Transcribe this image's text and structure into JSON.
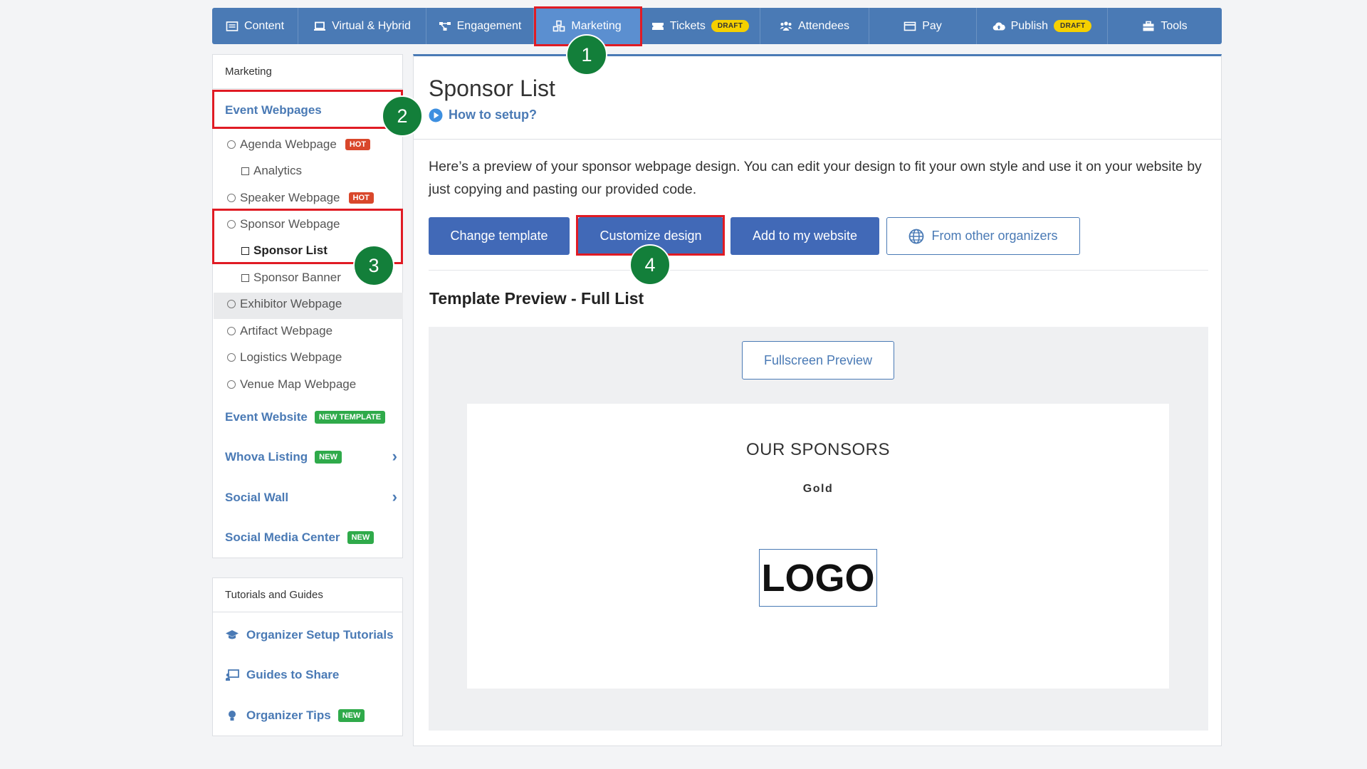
{
  "topnav": {
    "tabs": [
      {
        "label": "Content",
        "icon": "list-icon"
      },
      {
        "label": "Virtual & Hybrid",
        "icon": "laptop-icon"
      },
      {
        "label": "Engagement",
        "icon": "network-icon"
      },
      {
        "label": "Marketing",
        "icon": "cubes-icon",
        "active": true
      },
      {
        "label": "Tickets",
        "icon": "ticket-icon",
        "badge": "DRAFT"
      },
      {
        "label": "Attendees",
        "icon": "users-icon"
      },
      {
        "label": "Pay",
        "icon": "card-icon"
      },
      {
        "label": "Publish",
        "icon": "cloud-upload-icon",
        "badge": "DRAFT"
      },
      {
        "label": "Tools",
        "icon": "toolbox-icon"
      }
    ]
  },
  "steps": [
    "1",
    "2",
    "3",
    "4"
  ],
  "sidebar": {
    "heading": "Marketing",
    "event_webpages": "Event Webpages",
    "items": [
      {
        "label": "Agenda Webpage",
        "badge": "HOT"
      },
      {
        "label": "Analytics"
      },
      {
        "label": "Speaker Webpage",
        "badge": "HOT"
      },
      {
        "label": "Sponsor Webpage"
      },
      {
        "label": "Sponsor List"
      },
      {
        "label": "Sponsor Banner"
      },
      {
        "label": "Exhibitor Webpage"
      },
      {
        "label": "Artifact Webpage"
      },
      {
        "label": "Logistics Webpage"
      },
      {
        "label": "Venue Map Webpage"
      }
    ],
    "event_website": "Event Website",
    "event_website_badge": "NEW TEMPLATE",
    "whova_listing": "Whova Listing",
    "whova_listing_badge": "NEW",
    "social_wall": "Social Wall",
    "social_media_center": "Social Media Center",
    "social_media_center_badge": "NEW"
  },
  "tutorials": {
    "heading": "Tutorials and Guides",
    "items": [
      {
        "label": "Organizer Setup Tutorials",
        "icon": "graduation-cap-icon"
      },
      {
        "label": "Guides to Share",
        "icon": "presentation-icon"
      },
      {
        "label": "Organizer Tips",
        "icon": "lightbulb-icon",
        "badge": "NEW"
      }
    ]
  },
  "main": {
    "title": "Sponsor List",
    "how_to": "How to setup?",
    "description": "Here’s a preview of your sponsor webpage design. You can edit your design to fit your own style and use it on your website by just copying and pasting our provided code.",
    "buttons": {
      "change_template": "Change template",
      "customize_design": "Customize design",
      "add_to_website": "Add to my website",
      "from_other": "From other organizers"
    },
    "preview_heading": "Template Preview - Full List",
    "fullscreen": "Fullscreen Preview",
    "preview": {
      "title": "OUR SPONSORS",
      "tier": "Gold",
      "logo": "LOGO"
    }
  }
}
